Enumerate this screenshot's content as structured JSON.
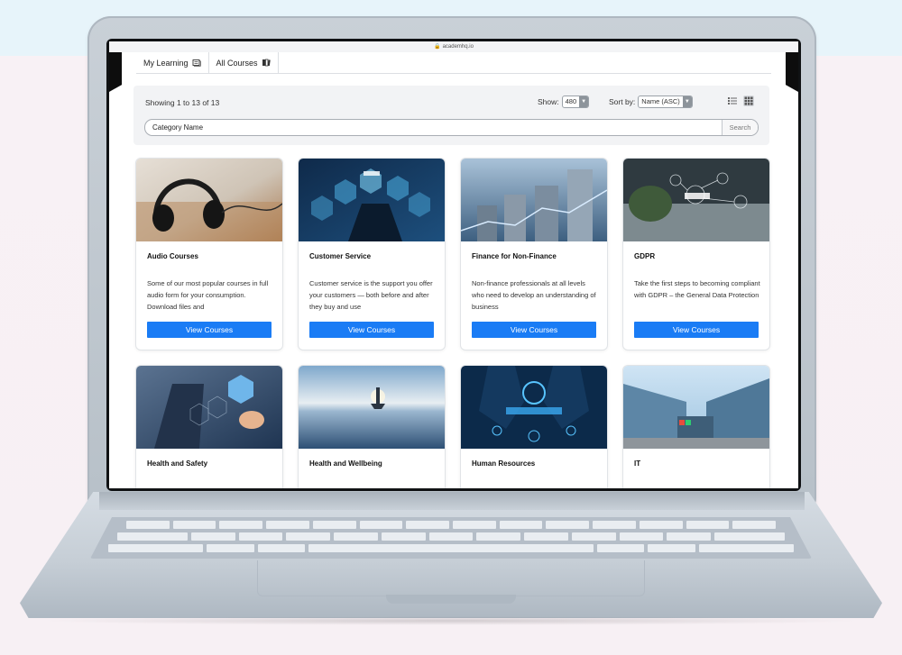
{
  "browser": {
    "url": "academhq.io"
  },
  "tabs": [
    {
      "label": "My Learning",
      "icon": "book-icon"
    },
    {
      "label": "All Courses",
      "icon": "books-icon"
    }
  ],
  "toolbar": {
    "showing_text": "Showing 1 to 13 of 13",
    "show_label": "Show:",
    "show_value": "480",
    "sort_label": "Sort by:",
    "sort_value": "Name (ASC)",
    "view_modes": [
      "list-view-icon",
      "grid-view-icon"
    ]
  },
  "search": {
    "value": "Category Name",
    "button_label": "Search"
  },
  "courses": [
    {
      "title": "Audio Courses",
      "description": "Some of our most popular courses in full audio form for your consumption. Download files and",
      "button_label": "View Courses"
    },
    {
      "title": "Customer Service",
      "description": "Customer service is the support you offer your customers — both before and after they buy and use",
      "button_label": "View Courses"
    },
    {
      "title": "Finance for Non-Finance",
      "description": "Non-finance professionals at all levels who need to develop an understanding of business",
      "button_label": "View Courses"
    },
    {
      "title": "GDPR",
      "description": "Take the first steps to becoming compliant with GDPR – the General Data Protection",
      "button_label": "View Courses"
    },
    {
      "title": "Health and Safety"
    },
    {
      "title": "Health and Wellbeing"
    },
    {
      "title": "Human Resources"
    },
    {
      "title": "IT"
    }
  ],
  "colors": {
    "accent_button": "#1a7cf5",
    "toolbar_bg": "#f2f3f5",
    "laptop_body": "#c6ced6"
  }
}
